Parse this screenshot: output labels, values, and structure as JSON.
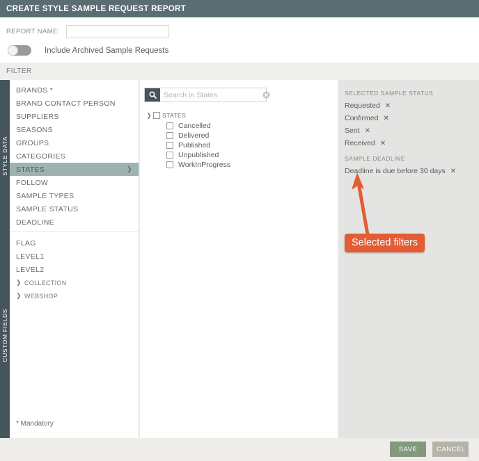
{
  "window": {
    "title": "CREATE STYLE SAMPLE REQUEST REPORT"
  },
  "form": {
    "report_name_label": "REPORT NAME:",
    "report_name_value": "",
    "report_name_placeholder": "",
    "toggle_label": "Include Archived Sample Requests",
    "toggle_state": "off"
  },
  "filter_bar": {
    "label": "FILTER"
  },
  "sidebar": {
    "tabs": [
      {
        "label": "STYLE DATA"
      },
      {
        "label": "CUSTOM FIELDS"
      }
    ],
    "style_data_items": [
      {
        "label": "BRANDS *",
        "active": false
      },
      {
        "label": "BRAND CONTACT PERSON",
        "active": false
      },
      {
        "label": "SUPPLIERS",
        "active": false
      },
      {
        "label": "SEASONS",
        "active": false
      },
      {
        "label": "GROUPS",
        "active": false
      },
      {
        "label": "CATEGORIES",
        "active": false
      },
      {
        "label": "STATES",
        "active": true
      },
      {
        "label": "FOLLOW",
        "active": false
      },
      {
        "label": "SAMPLE TYPES",
        "active": false
      },
      {
        "label": "SAMPLE STATUS",
        "active": false
      },
      {
        "label": "DEADLINE",
        "active": false
      }
    ],
    "custom_fields_items": [
      {
        "label": "FLAG",
        "expandable": false
      },
      {
        "label": "LEVEL1",
        "expandable": false
      },
      {
        "label": "LEVEL2",
        "expandable": false
      },
      {
        "label": "COLLECTION",
        "expandable": true
      },
      {
        "label": "WEBSHOP",
        "expandable": true
      }
    ],
    "mandatory_note": "* Mandatory"
  },
  "search": {
    "placeholder": "Search in States",
    "value": "",
    "icon": "search-icon",
    "clear_icon": "clear-circle-icon"
  },
  "tree": {
    "root_label": "STATES",
    "root_checked": false,
    "items": [
      {
        "label": "Cancelled",
        "checked": false
      },
      {
        "label": "Delivered",
        "checked": false
      },
      {
        "label": "Published",
        "checked": false
      },
      {
        "label": "Unpublished",
        "checked": false
      },
      {
        "label": "WorkInProgress",
        "checked": false
      }
    ]
  },
  "selected": {
    "status_header": "SELECTED SAMPLE STATUS",
    "status_chips": [
      {
        "label": "Requested",
        "remove": "✕"
      },
      {
        "label": "Confirmed",
        "remove": "✕"
      },
      {
        "label": "Sent",
        "remove": "✕"
      },
      {
        "label": "Received",
        "remove": "✕"
      }
    ],
    "deadline_header": "SAMPLE DEADLINE",
    "deadline_chips": [
      {
        "label": "Deadline is due before 30 days",
        "remove": "✕"
      }
    ]
  },
  "annotation": {
    "callout_text": "Selected filters",
    "callout_color": "#e45c35"
  },
  "footer": {
    "save_label": "SAVE",
    "cancel_label": "CANCEL",
    "save_color": "#82997b",
    "cancel_color": "#b5b2a8"
  }
}
